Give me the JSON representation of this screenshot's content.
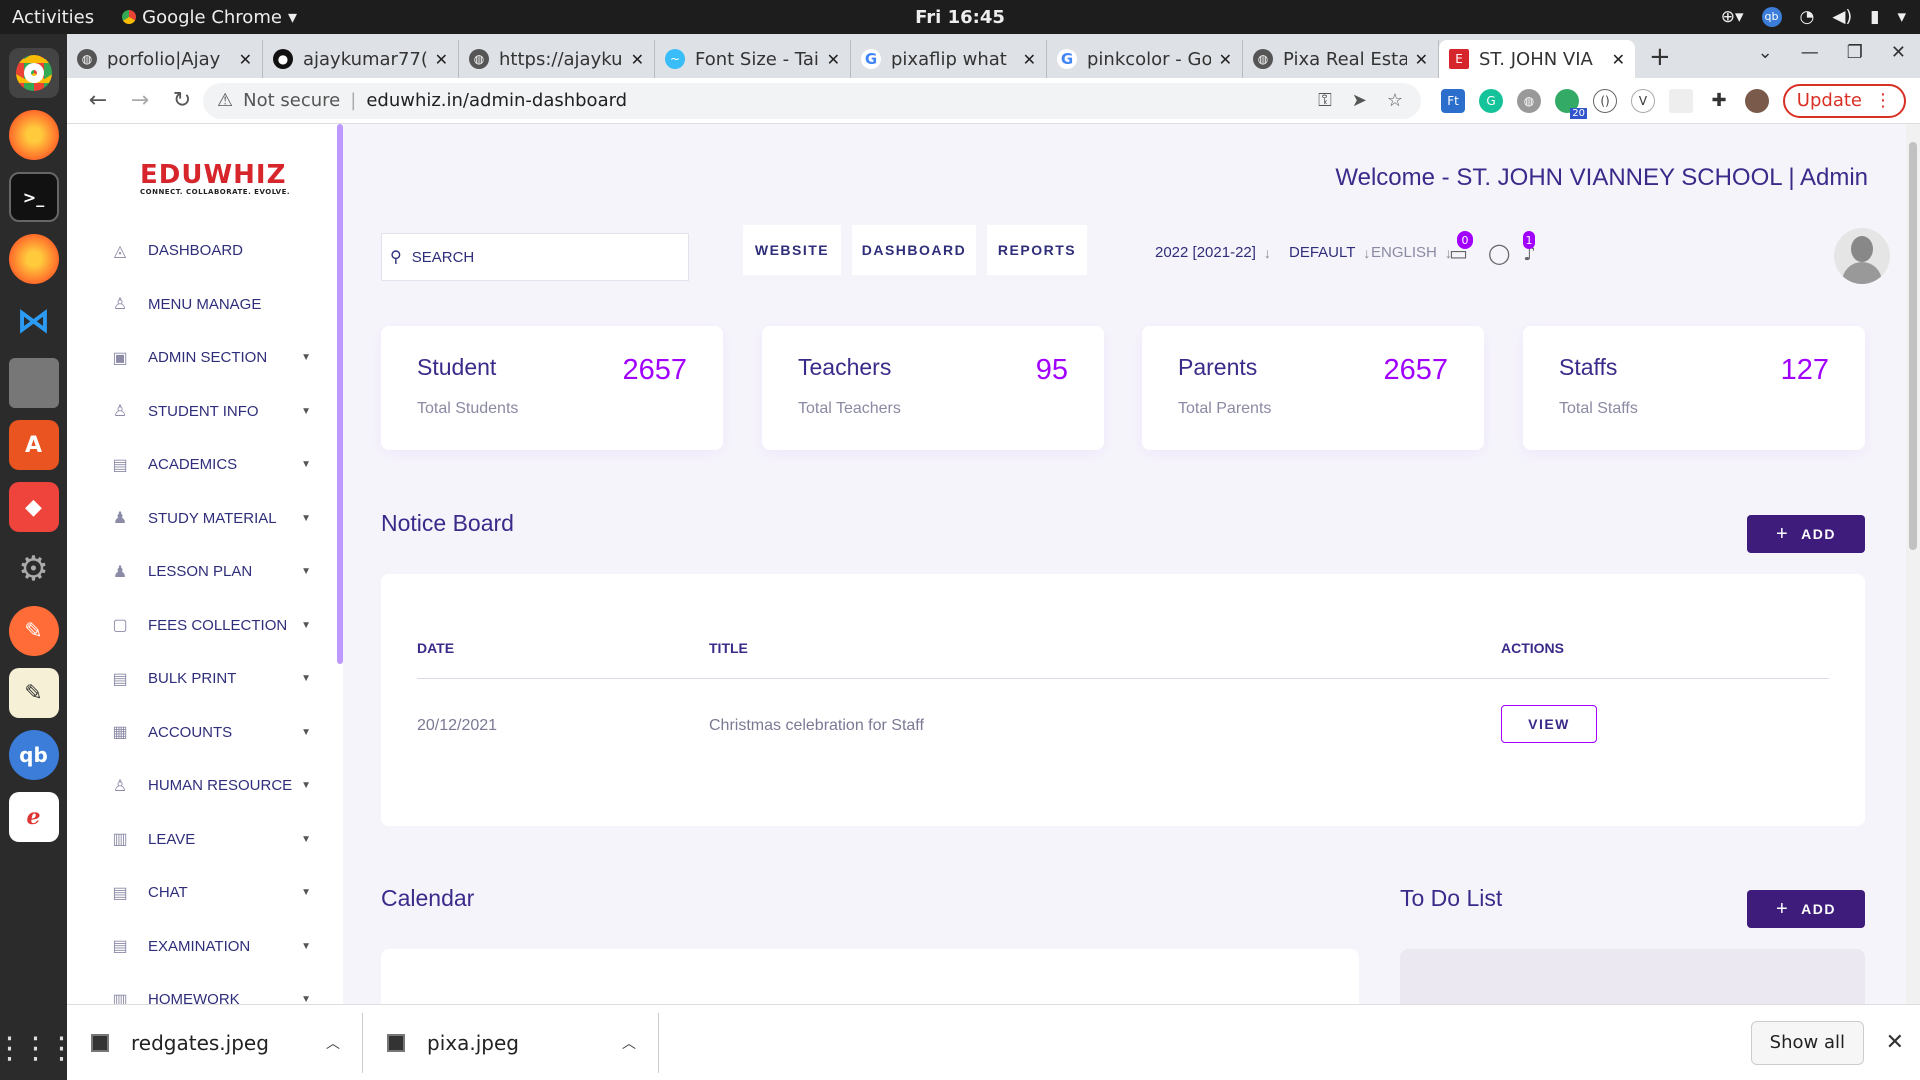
{
  "os": {
    "activities": "Activities",
    "app_name": "Google Chrome",
    "clock": "Fri 16:45"
  },
  "browser": {
    "tabs": [
      {
        "title": "porfolio|Ajay"
      },
      {
        "title": "ajaykumar77("
      },
      {
        "title": "https://ajayku"
      },
      {
        "title": "Font Size - Tai"
      },
      {
        "title": "pixaflip what"
      },
      {
        "title": "pinkcolor - Go"
      },
      {
        "title": "Pixa Real Esta"
      },
      {
        "title": "ST. JOHN VIA"
      }
    ],
    "not_secure": "Not secure",
    "url": "eduwhiz.in/admin-dashboard",
    "update_label": "Update",
    "ext_badge": "20"
  },
  "sidebar": {
    "logo": "EDUWHIZ",
    "logo_tagline": "CONNECT. COLLABORATE. EVOLVE.",
    "items": [
      {
        "label": "DASHBOARD",
        "icon": "dashboard-icon",
        "caret": false
      },
      {
        "label": "MENU MANAGE",
        "icon": "user-icon",
        "caret": false
      },
      {
        "label": "ADMIN SECTION",
        "icon": "admin-icon",
        "caret": true
      },
      {
        "label": "STUDENT INFO",
        "icon": "student-icon",
        "caret": true
      },
      {
        "label": "ACADEMICS",
        "icon": "academics-icon",
        "caret": true
      },
      {
        "label": "STUDY MATERIAL",
        "icon": "study-icon",
        "caret": true
      },
      {
        "label": "LESSON PLAN",
        "icon": "lesson-icon",
        "caret": true
      },
      {
        "label": "FEES COLLECTION",
        "icon": "fees-icon",
        "caret": true
      },
      {
        "label": "BULK PRINT",
        "icon": "print-icon",
        "caret": true
      },
      {
        "label": "ACCOUNTS",
        "icon": "accounts-icon",
        "caret": true
      },
      {
        "label": "HUMAN RESOURCE",
        "icon": "hr-icon",
        "caret": true
      },
      {
        "label": "LEAVE",
        "icon": "leave-icon",
        "caret": true
      },
      {
        "label": "CHAT",
        "icon": "chat-icon",
        "caret": true
      },
      {
        "label": "EXAMINATION",
        "icon": "exam-icon",
        "caret": true
      },
      {
        "label": "HOMEWORK",
        "icon": "homework-icon",
        "caret": true
      }
    ]
  },
  "header": {
    "welcome": "Welcome - ST. JOHN VIANNEY SCHOOL | Admin",
    "search_placeholder": "SEARCH",
    "nav_buttons": [
      "WEBSITE",
      "DASHBOARD",
      "REPORTS"
    ],
    "session": "2022 [2021-22]",
    "theme": "DEFAULT",
    "language": "ENGLISH",
    "chat_badge": "0",
    "notif_badge": "1"
  },
  "stats": [
    {
      "label": "Student",
      "sub": "Total Students",
      "value": "2657"
    },
    {
      "label": "Teachers",
      "sub": "Total Teachers",
      "value": "95"
    },
    {
      "label": "Parents",
      "sub": "Total Parents",
      "value": "2657"
    },
    {
      "label": "Staffs",
      "sub": "Total Staffs",
      "value": "127"
    }
  ],
  "notice_board": {
    "title": "Notice Board",
    "add_label": "ADD",
    "columns": [
      "DATE",
      "TITLE",
      "ACTIONS"
    ],
    "rows": [
      {
        "date": "20/12/2021",
        "title": "Christmas celebration for Staff",
        "action": "VIEW"
      }
    ]
  },
  "calendar": {
    "title": "Calendar"
  },
  "todo": {
    "title": "To Do List",
    "add_label": "ADD"
  },
  "downloads": {
    "items": [
      "redgates.jpeg",
      "pixa.jpeg"
    ],
    "show_all": "Show all"
  },
  "colors": {
    "accent": "#a100ff",
    "primary": "#3b2a8a",
    "button": "#3d1c7b"
  }
}
